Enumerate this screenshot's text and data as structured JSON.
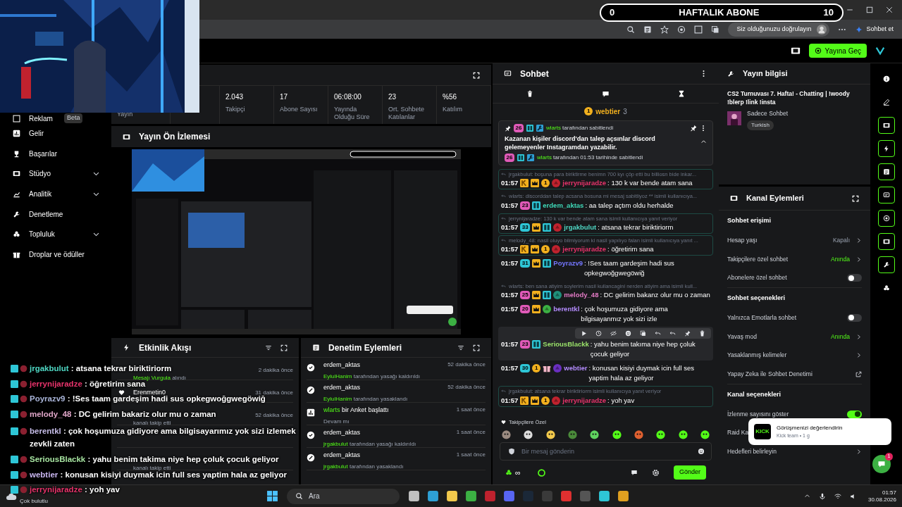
{
  "goal": {
    "start": "0",
    "title": "HAFTALIK ABONE",
    "end": "10"
  },
  "browser": {
    "verify": "Siz olduğunuzu doğrulayın",
    "chat": "Sohbet et"
  },
  "header": {
    "go_live": "Yayına Geç"
  },
  "sidebar": [
    {
      "label": "Reklam",
      "badge": "Beta",
      "submenu": false
    },
    {
      "label": "Gelir",
      "submenu": false
    },
    {
      "label": "Başarılar",
      "submenu": false
    },
    {
      "label": "Stüdyo",
      "submenu": true
    },
    {
      "label": "Analitik",
      "submenu": true
    },
    {
      "label": "Denetleme",
      "submenu": false
    },
    {
      "label": "Topluluk",
      "submenu": true
    },
    {
      "label": "Droplar ve ödüller",
      "submenu": false
    }
  ],
  "stats": [
    {
      "label": "Yayın"
    },
    {
      "value": "2.043",
      "label": "Takipçi"
    },
    {
      "value": "17",
      "label": "Abone Sayısı"
    },
    {
      "value": "06:08:00",
      "label": "Yayında Olduğu Süre"
    },
    {
      "value": "23",
      "label": "Ort. Sohbete Katılanlar"
    },
    {
      "value": "%56",
      "label": "Katılım"
    }
  ],
  "preview": {
    "title": "Yayın Ön İzlemesi"
  },
  "activity": {
    "title": "Etkinlik Akışı",
    "items": [
      {
        "kind": "highlight",
        "covered": true,
        "actor": "Mesajı Vurgula",
        "action": "alındı",
        "time": "2 dakika önce"
      },
      {
        "kind": "follow",
        "covered": false,
        "name": "Erenmetin0",
        "time": "31 dakika önce"
      },
      {
        "kind": "follow",
        "covered": true,
        "action": "kanalı takip etti",
        "time": "52 dakika önce"
      },
      {
        "kind": "follow",
        "covered": true
      },
      {
        "kind": "follow",
        "covered": true,
        "action": "kanalı takip etti"
      }
    ]
  },
  "moderation": {
    "title": "Denetim Eylemleri",
    "items": [
      {
        "kind": "unban",
        "name": "erdem_aktas",
        "actor": "EylulHanim",
        "action": "tarafından yasağı kaldırıldı",
        "time": "52 dakika önce"
      },
      {
        "kind": "ban",
        "name": "erdem_aktas",
        "actor": "EylulHanim",
        "action": "tarafından yasaklandı",
        "time": "52 dakika önce"
      },
      {
        "kind": "poll",
        "actor": "wlarts",
        "name": "bir Anket başlattı",
        "action": "Devam mı",
        "time": "1 saat önce"
      },
      {
        "kind": "unban",
        "name": "erdem_aktas",
        "actor": "jrgakbulut",
        "action": "tarafından yasağı kaldırıldı",
        "time": "1 saat önce"
      },
      {
        "kind": "ban",
        "name": "erdem_aktas",
        "actor": "jrgakbulut",
        "action": "tarafından yasaklandı",
        "time": "1 saat önce"
      }
    ]
  },
  "overlay_chat": [
    {
      "user": "jrgakbulut",
      "color": "#4fd8c4",
      "text": ": atsana tekrar biriktiriorm"
    },
    {
      "user": "jerrynijaradze",
      "color": "#e8336b",
      "text": ": öğretirim sana"
    },
    {
      "user": "Poyrazv9",
      "color": "#a9b4d8",
      "text": ": !Ses taam gardeşim hadi sus opkegwoğgwegöwiğ"
    },
    {
      "user": "melody_48",
      "color": "#e0a6c8",
      "text": ": DC gelirim bakariz olur mu o zaman"
    },
    {
      "user": "berentkl",
      "color": "#c6bde8",
      "text": ": çok hoşumuza gidiyore ama bilgisayarımız yok sizi izlemek zevkli zaten"
    },
    {
      "user": "SeriousBlackk",
      "color": "#a6e3a0",
      "text": ": yahu benim takima niye hep çoluk çocuk geliyor"
    },
    {
      "user": "webtier",
      "color": "#c9b6f0",
      "text": ": konusan kisiyi duymak icin full ses yaptim hala az geliyor"
    },
    {
      "user": "jerrynijaradze",
      "color": "#e8336b",
      "text": ": yoh yav"
    }
  ],
  "chat": {
    "title": "Sohbet",
    "top_gifter": {
      "coin": "1",
      "user": "webtier",
      "count": "3"
    },
    "pinned": {
      "badge": "26",
      "user": "wlarts",
      "by": "tarafından sabitlendi",
      "text": "Kazanan kişiler discord'dan talep açsınlar discord gelemeyenler Instagramdan yazabilir.",
      "footer_badge": "26",
      "footer_user": "wlarts",
      "footer": "tarafından 01:53 tarihinde sabitlendi"
    },
    "messages": [
      {
        "reply": "jrgakbulut: boşuna para biriktirme benimn 700 kyı çöp etti bu billiosn bide inkar...",
        "time": "01:57",
        "badges": [
          {
            "kind": "k"
          },
          {
            "kind": "crown"
          },
          {
            "kind": "coin",
            "text": "1"
          },
          {
            "kind": "avatar",
            "color": "#c0222e"
          }
        ],
        "user": "jerrynijaradze",
        "color": "#e8336b",
        "text": ": 130 k var bende atam sana",
        "boxed": true
      },
      {
        "reply": "wlarts: discorddan talep acsana bosuna mi mesaj sabitliyoz ** isimli kullanıcıya...",
        "time": "01:57",
        "badges": [
          {
            "kind": "sub",
            "text": "23",
            "color": "#e05ab8"
          },
          {
            "kind": "bg"
          }
        ],
        "user": "erdem_aktas",
        "color": "#3fd9b8",
        "text": ": aa talep açtım oldu herhalde",
        "boxed": false
      },
      {
        "reply": "jerrynijaradze: 130 k var bende atam sana isimli kullanıcıya yanıt veriyor",
        "time": "01:57",
        "badges": [
          {
            "kind": "sub",
            "text": "33",
            "color": "#2ec6d6"
          },
          {
            "kind": "crown"
          },
          {
            "kind": "bg"
          },
          {
            "kind": "avatar",
            "color": "#c0222e"
          }
        ],
        "user": "jrgakbulut",
        "color": "#4fd8c4",
        "text": ": atsana tekrar biriktiriorm",
        "boxed": true
      },
      {
        "reply": "melody_48: nasil oluyo bilmiyorum ki nasil yapılıyo falan isimli kullanıcıya yanıt ...",
        "time": "01:57",
        "badges": [
          {
            "kind": "k"
          },
          {
            "kind": "crown"
          },
          {
            "kind": "coin",
            "text": "1"
          },
          {
            "kind": "avatar",
            "color": "#c0222e"
          }
        ],
        "user": "jerrynijaradze",
        "color": "#e8336b",
        "text": ": öğretirim sana",
        "boxed": true
      },
      {
        "time": "01:57",
        "badges": [
          {
            "kind": "sub",
            "text": "31",
            "color": "#2ec6d6"
          },
          {
            "kind": "crown"
          },
          {
            "kind": "bg"
          }
        ],
        "user": "Poyrazv9",
        "color": "#7477ff",
        "text": ": !Ses taam gardeşim hadi sus opkegwoğgwegöwiğ",
        "boxed": false
      },
      {
        "reply": "wlarts: ben sana atiyim soylerim nasil kullancagini nerden atiyim ama isimli kull...",
        "time": "01:57",
        "badges": [
          {
            "kind": "sub",
            "text": "25",
            "color": "#e05ab8"
          },
          {
            "kind": "crown"
          },
          {
            "kind": "bg"
          },
          {
            "kind": "avatar",
            "color": "#1f8f7a"
          }
        ],
        "user": "melody_48",
        "color": "#e27ac4",
        "text": ": DC gelirim bakanz olur mu o zaman",
        "boxed": false
      },
      {
        "time": "01:57",
        "badges": [
          {
            "kind": "sub",
            "text": "20",
            "color": "#e05ab8"
          },
          {
            "kind": "crown"
          },
          {
            "kind": "avatar",
            "color": "#3cb043"
          }
        ],
        "user": "berentkl",
        "color": "#b48cff",
        "text": ": çok hoşumuza gidiyore ama bilgisayanmız yok sizi izle",
        "boxed": false
      },
      {
        "time": "01:57",
        "badges": [
          {
            "kind": "sub",
            "text": "23",
            "color": "#e05ab8"
          },
          {
            "kind": "bg"
          }
        ],
        "user": "SeriousBlackk",
        "color": "#9be36a",
        "text": ": yahu benim takıma niye hep çoluk çocuk geliyor",
        "boxed": false,
        "hovered": true
      },
      {
        "time": "01:57",
        "badges": [
          {
            "kind": "sub",
            "text": "30",
            "color": "#2ec6d6"
          },
          {
            "kind": "coin",
            "text": "1"
          },
          {
            "kind": "gift"
          },
          {
            "kind": "avatar",
            "color": "#6a2fc0"
          }
        ],
        "user": "webtier",
        "color": "#b48cff",
        "text": ": konusan kisiyi duymak icin full ses yaptim hala az geliyor",
        "boxed": false
      },
      {
        "reply": "jrgakbulut: atsana tekrar biriktiriorm isimli kullanıcıya yanıt veriyor",
        "time": "01:57",
        "badges": [
          {
            "kind": "k"
          },
          {
            "kind": "crown"
          },
          {
            "kind": "coin",
            "text": "1"
          },
          {
            "kind": "avatar",
            "color": "#c0222e"
          }
        ],
        "user": "jerrynijaradze",
        "color": "#e8336b",
        "text": ": yoh yav",
        "boxed": true
      }
    ],
    "emotes_label": "Takipçilere Özel",
    "placeholder": "Bir mesaj gönderin",
    "infinity": "∞",
    "send": "Gönder"
  },
  "stream_info": {
    "title": "Yayın bilgisi",
    "stream_title": "CS2 Turnuvası 7. Hafta! - Chatting | !woody !blerp !link !insta",
    "category": "Sadece Sohbet",
    "tag": "Turkish"
  },
  "channel_actions": {
    "title": "Kanal Eylemleri",
    "sections": [
      {
        "title": "Sohbet erişimi",
        "rows": [
          {
            "kind": "value",
            "label": "Hesap yaşı",
            "value": "Kapalı",
            "active": false
          },
          {
            "kind": "value",
            "label": "Takipçilere özel sohbet",
            "value": "Anında",
            "active": true
          },
          {
            "kind": "toggle",
            "label": "Abonelere özel sohbet",
            "on": false
          }
        ]
      },
      {
        "title": "Sohbet seçenekleri",
        "rows": [
          {
            "kind": "toggle",
            "label": "Yalnızca Emotlarla sohbet",
            "on": false
          },
          {
            "kind": "value",
            "label": "Yavaş mod",
            "value": "Anında",
            "active": true
          },
          {
            "kind": "link",
            "label": "Yasaklanmış kelimeler"
          },
          {
            "kind": "external",
            "label": "Yapay Zeka ile Sohbet Denetimi"
          }
        ]
      },
      {
        "title": "Kanal seçenekleri",
        "rows": [
          {
            "kind": "toggle",
            "label": "İzlenme sayısını göster",
            "on": true
          },
          {
            "kind": "plain",
            "label": "Raid Ka"
          },
          {
            "kind": "link",
            "label": "Hedefleri belirleyin"
          }
        ]
      }
    ]
  },
  "toast": {
    "title": "Görüşmenizi değerlendirin",
    "subtitle": "Kick team • 1 g",
    "logo": "KICK"
  },
  "help_badge": "1",
  "taskbar": {
    "weather": "Çok bulutlu",
    "search": "Ara",
    "time": "01:57",
    "date": "30.08.2026"
  }
}
